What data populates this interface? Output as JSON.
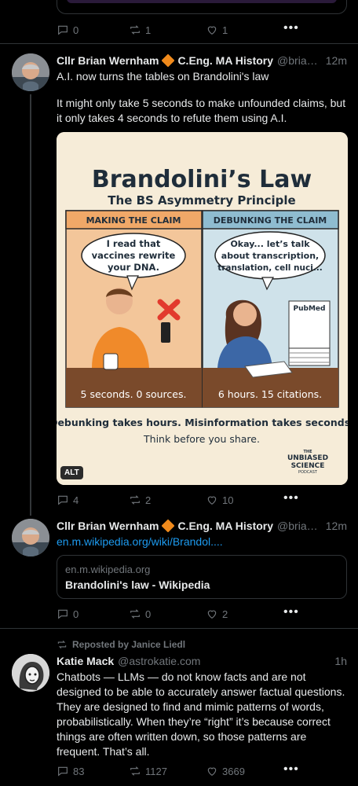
{
  "top_post": {
    "replies": "0",
    "reposts": "1",
    "likes": "1"
  },
  "post1": {
    "author": "Cllr Brian Wernham",
    "credentials": "C.Eng.  MA History",
    "handle": "@brian...",
    "time": "12m",
    "line1": "A.I. now turns the tables on Brandolini's law",
    "line2": "It might only take 5 seconds to make unfounded claims, but it only takes 4 seconds to refute them using A.I.",
    "alt_badge": "ALT",
    "replies": "4",
    "reposts": "2",
    "likes": "10",
    "image": {
      "title": "Brandolini’s Law",
      "subtitle": "The BS Asymmetry Principle",
      "left_header": "MAKING THE CLAIM",
      "right_header": "DEBUNKING THE CLAIM",
      "left_bubble": [
        "I read that",
        "vaccines rewrite",
        "your DNA."
      ],
      "right_bubble": [
        "Okay... let’s talk",
        "about transcription,",
        "translation, cell nuci..."
      ],
      "pubmed": "PubMed",
      "left_caption": "5 seconds. 0 sources.",
      "right_caption": "6 hours. 15 citations.",
      "footer1": "Debunking takes hours. Misinformation takes seconds.",
      "footer2": "Think before you share.",
      "logo_small": "THE",
      "logo_line1": "UNBIASED",
      "logo_line2": "SCIENCE",
      "logo_line3": "PODCAST"
    }
  },
  "post2": {
    "author": "Cllr Brian Wernham",
    "credentials": "C.Eng.  MA History",
    "handle": "@brian...",
    "time": "12m",
    "link_text": "en.m.wikipedia.org/wiki/Brandol....",
    "card_domain": "en.m.wikipedia.org",
    "card_title": "Brandolini's law - Wikipedia",
    "replies": "0",
    "reposts": "0",
    "likes": "2"
  },
  "post3": {
    "repost_label": "Reposted by Janice Liedl",
    "author": "Katie Mack",
    "handle": "@astrokatie.com",
    "time": "1h",
    "body": "Chatbots — LLMs — do not know facts and are not designed to be able to accurately answer factual questions. They are designed to find and mimic patterns of words, probabilistically. When they’re “right” it’s because correct things are often written down, so those patterns are frequent. That’s all.",
    "replies": "83",
    "reposts": "1127",
    "likes": "3669"
  },
  "colors": {
    "background": "#000000",
    "text": "#e7e9ea",
    "muted": "#71767b",
    "link": "#1d9bf0",
    "divider": "#2f3336",
    "diamond": "#f08a1c"
  }
}
